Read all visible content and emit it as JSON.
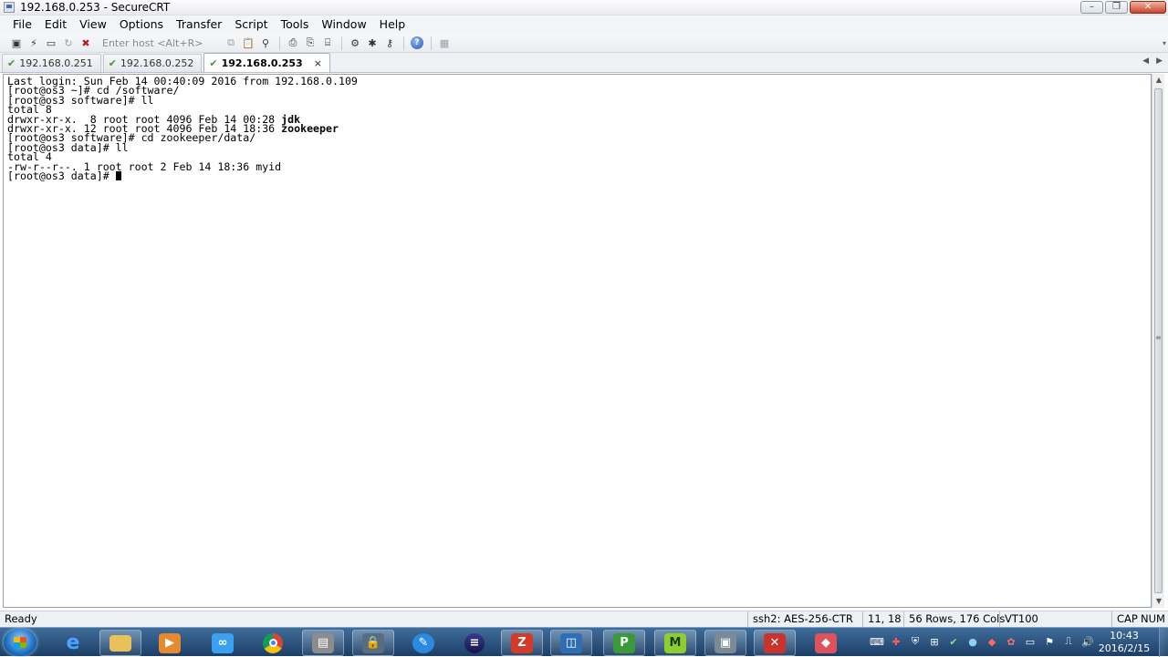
{
  "window": {
    "title": "192.168.0.253 - SecureCRT",
    "controls": {
      "minimize": "–",
      "maximize": "❐",
      "close": "✕"
    }
  },
  "menu": [
    "File",
    "Edit",
    "View",
    "Options",
    "Transfer",
    "Script",
    "Tools",
    "Window",
    "Help"
  ],
  "toolbar": {
    "host_placeholder": "Enter host <Alt+R>",
    "icons": [
      "connect-icon",
      "quick-connect-icon",
      "connect-tab-icon",
      "reconnect-icon",
      "disconnect-icon",
      "copy-icon",
      "paste-icon",
      "find-icon",
      "print-icon",
      "print-selection-icon",
      "print-setup-icon",
      "session-options-icon",
      "global-options-icon",
      "keymap-icon",
      "help-icon",
      "sftp-icon"
    ]
  },
  "tabs": [
    {
      "label": "192.168.0.251",
      "active": false
    },
    {
      "label": "192.168.0.252",
      "active": false
    },
    {
      "label": "192.168.0.253",
      "active": true
    }
  ],
  "tab_close": "×",
  "terminal": {
    "lines": [
      {
        "text": "Last login: Sun Feb 14 00:40:09 2016 from 192.168.0.109"
      },
      {
        "text": "[root@os3 ~]# cd /software/"
      },
      {
        "text": "[root@os3 software]# ll"
      },
      {
        "text": "total 8"
      },
      {
        "text": "drwxr-xr-x.  8 root root 4096 Feb 14 00:28 ",
        "bold": "jdk"
      },
      {
        "text": "drwxr-xr-x. 12 root root 4096 Feb 14 18:36 ",
        "bold": "zookeeper"
      },
      {
        "text": "[root@os3 software]# cd zookeeper/data/"
      },
      {
        "text": "[root@os3 data]# ll"
      },
      {
        "text": "total 4"
      },
      {
        "text": "-rw-r--r--. 1 root root 2 Feb 14 18:36 myid"
      },
      {
        "text": "[root@os3 data]# ",
        "cursor": true
      }
    ]
  },
  "status": {
    "ready": "Ready",
    "encryption": "ssh2: AES-256-CTR",
    "position": "11,  18",
    "size": "56 Rows, 176 Cols",
    "emulation": "VT100",
    "caps": "CAP",
    "num": "NUM"
  },
  "taskbar": {
    "apps": [
      "internet-explorer",
      "file-explorer",
      "media-player",
      "baidu-netdisk",
      "chrome",
      "securecrt-manager",
      "security-tool",
      "note-app",
      "eclipse",
      "filezilla",
      "virtualbox",
      "project-app",
      "mindmanager-app",
      "securecrt",
      "xmind-app",
      "eraser-app"
    ],
    "clock_time": "10:43",
    "clock_date": "2016/2/15"
  },
  "colors": {
    "tab_check": "#3c9b2f",
    "taskbar_top": "#3f6d9a",
    "taskbar_bottom": "#1c3e66"
  }
}
